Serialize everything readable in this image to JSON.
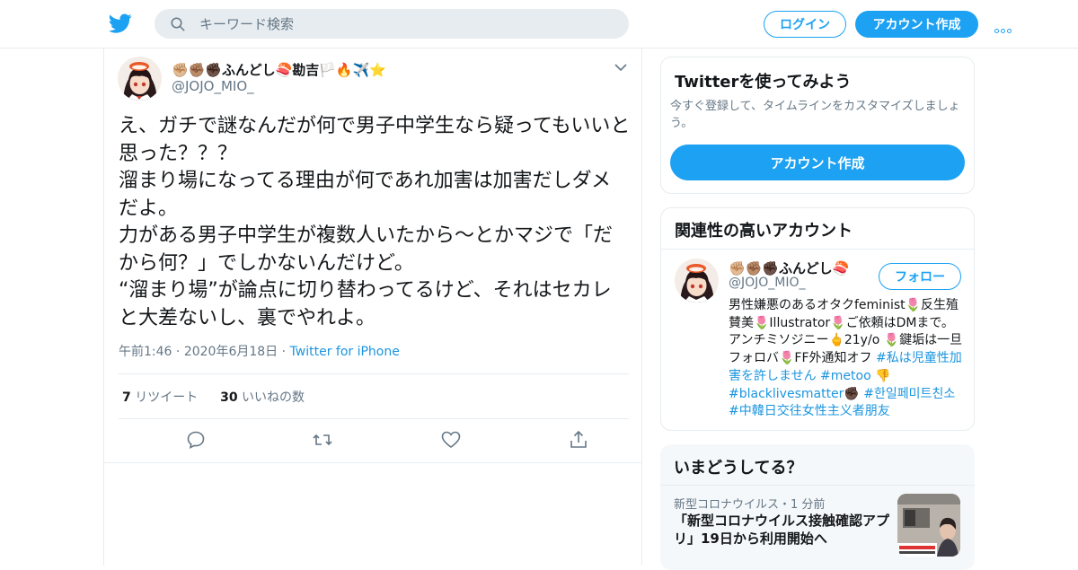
{
  "header": {
    "search_placeholder": "キーワード検索",
    "login_label": "ログイン",
    "signup_label": "アカウント作成",
    "brand_color": "#1da1f2"
  },
  "tweet": {
    "author_name": "✊🏼✊🏽✊🏿ふんどし🍣勘吉🏳️🔥✈️⭐️",
    "author_handle": "@JOJO_MIO_",
    "text": "え、ガチで謎なんだが何で男子中学生なら疑ってもいいと思った？？？\n溜まり場になってる理由が何であれ加害は加害だしダメだよ。\n力がある男子中学生が複数人いたから〜とかマジで「だから何？」でしかないんだけど。\n“溜まり場”が論点に切り替わってるけど、それはセカレと大差ないし、裏でやれよ。",
    "time": "午前1:46",
    "date": "2020年6月18日",
    "source": "Twitter for iPhone",
    "retweet_count": "7",
    "retweet_label": "リツイート",
    "like_count": "30",
    "like_label": "いいねの数"
  },
  "sidebar": {
    "try_title": "Twitterを使ってみよう",
    "try_subtitle": "今すぐ登録して、タイムラインをカスタマイズしましょう。",
    "try_button": "アカウント作成",
    "related_title": "関連性の高いアカウント",
    "related_name": "✊🏼✊🏽✊🏿ふんどし🍣",
    "related_handle": "@JOJO_MIO_",
    "follow_label": "フォロー",
    "bio_text": "男性嫌悪のあるオタクfeminist🌷反生殖賛美🌷Illustrator🌷ご依頼はDMまで。アンチミソジニー🖕21y/o 🌷鍵垢は一旦フォロバ🌷FF外通知オフ ",
    "bio_tags": "#私は児童性加害を許しません #metoo 👎 #blacklivesmatter✊🏿 #한일페미트친소 #中韓日交往女性主义者朋友",
    "trends_title": "いまどうしてる？",
    "trend_meta": "新型コロナウイルス・1 分前",
    "trend_title": "「新型コロナウイルス接触確認アプリ」19日から利用開始へ"
  }
}
